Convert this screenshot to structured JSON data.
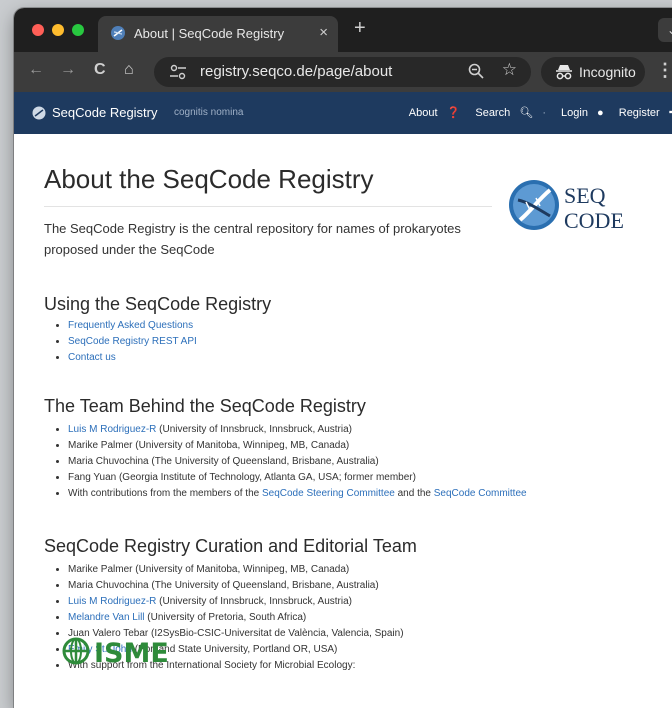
{
  "browser": {
    "tab_title": "About | SeqCode Registry",
    "tab_close": "×",
    "new_tab": "+",
    "tab_menu": "⌄",
    "back": "←",
    "forward": "→",
    "reload": "C",
    "home": "⌂",
    "url": "registry.seqco.de/page/about",
    "star": "☆",
    "incognito_label": "Incognito",
    "menu": "⋮"
  },
  "site_nav": {
    "brand": "SeqCode Registry",
    "tagline": "cognitis nomina",
    "about": "About",
    "search": "Search",
    "separator": "·",
    "login": "Login",
    "register": "Register"
  },
  "page": {
    "title": "About the SeqCode Registry",
    "lead": "The SeqCode Registry is the central repository for names of prokaryotes proposed under the SeqCode",
    "logo_line1": "SEQ",
    "logo_line2": "CODE"
  },
  "using": {
    "heading": "Using the SeqCode Registry",
    "items": [
      "Frequently Asked Questions",
      "SeqCode Registry REST API",
      "Contact us"
    ]
  },
  "team": {
    "heading": "The Team Behind the SeqCode Registry",
    "m1_link": "Luis M Rodriguez-R",
    "m1_rest": " (University of Innsbruck, Innsbruck, Austria)",
    "m2": "Marike Palmer (University of Manitoba, Winnipeg, MB, Canada)",
    "m3": "Maria Chuvochina (The University of Queensland, Brisbane, Australia)",
    "m4": "Fang Yuan (Georgia Institute of Technology, Atlanta GA, USA; former member)",
    "m5_pre": "With contributions from the members of the ",
    "m5_link1": "SeqCode Steering Committee",
    "m5_mid": " and the ",
    "m5_link2": "SeqCode Committee"
  },
  "curation": {
    "heading": "SeqCode Registry Curation and Editorial Team",
    "c1": "Marike Palmer (University of Manitoba, Winnipeg, MB, Canada)",
    "c2": "Maria Chuvochina (The University of Queensland, Brisbane, Australia)",
    "c3_link": "Luis M Rodriguez-R",
    "c3_rest": " (University of Innsbruck, Innsbruck, Austria)",
    "c4_link": "Melandre Van Lill",
    "c4_rest": " (University of Pretoria, South Africa)",
    "c5": "Juan Valero Tebar (I2SysBio-CSIC-Universitat de València, Valencia, Spain)",
    "c6_link": "Emily St. John",
    "c6_rest": " (Portland State University, Portland OR, USA)",
    "c7": "With support from the International Society for Microbial Ecology:",
    "isme_logo": "ISME"
  },
  "colors": {
    "navbar": "#1e3a5f",
    "link": "#2c6fba",
    "isme_green": "#2e8b3a"
  }
}
